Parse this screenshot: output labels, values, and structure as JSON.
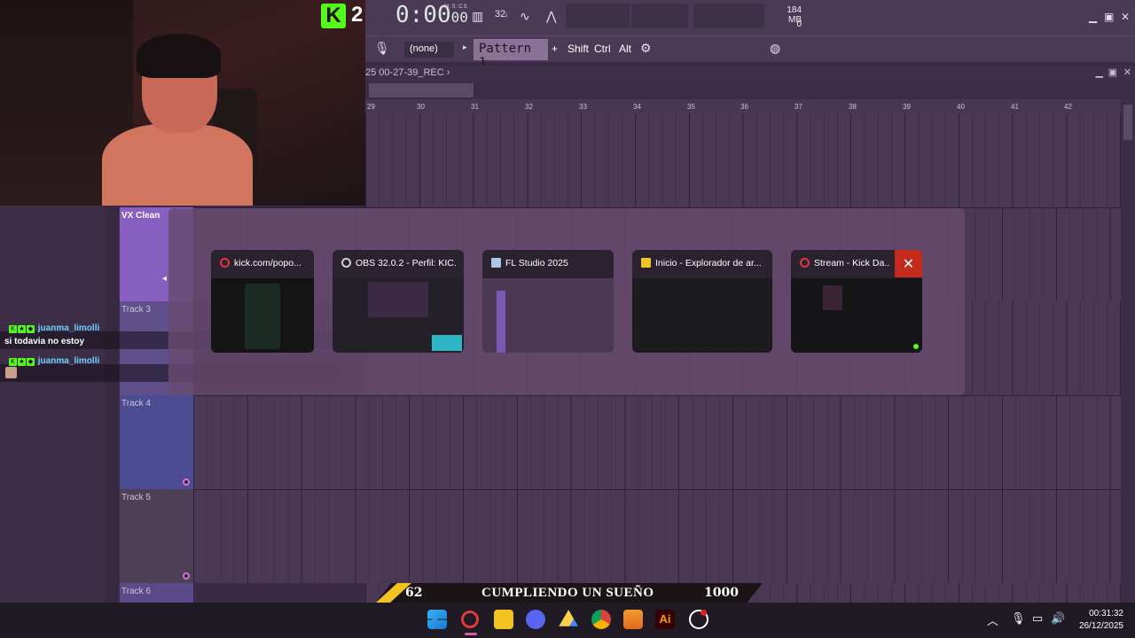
{
  "stream": {
    "platform_badge": "K",
    "viewer_count": "2"
  },
  "fl": {
    "time_main": "0:00",
    "time_sub": "00",
    "time_mode": "M:S:CS",
    "mem_mb": "184 MB",
    "mem_sub": "0",
    "input_select": "(none)",
    "pattern_label": "Pattern 1",
    "pattern_add": "+",
    "modifiers": [
      "Shift",
      "Ctrl",
      "Alt"
    ],
    "playlist_title": "25 00-27-39_REC",
    "ruler": [
      "29",
      "30",
      "31",
      "32",
      "33",
      "34",
      "35",
      "36",
      "37",
      "38",
      "39",
      "40",
      "41",
      "42"
    ],
    "tracks": [
      {
        "name": "VX Clean"
      },
      {
        "name": "Track 3"
      },
      {
        "name": "Track 4"
      },
      {
        "name": "Track 5"
      },
      {
        "name": "Track 6"
      }
    ]
  },
  "chat": {
    "messages": [
      {
        "user": "juanma_limolli",
        "text": "si todavia no estoy"
      },
      {
        "user": "juanma_limolli",
        "text": ""
      }
    ]
  },
  "alttab": {
    "windows": [
      {
        "title": "kick.com/popo...",
        "icon": "opera-icon",
        "color": "#e03a3a"
      },
      {
        "title": "OBS 32.0.2 - Perfil: KIC...",
        "icon": "obs-icon",
        "color": "#cfcfcf"
      },
      {
        "title": "FL Studio 2025",
        "icon": "fl-studio-icon",
        "color": "#f29a2e"
      },
      {
        "title": "Inicio - Explorador de ar...",
        "icon": "folder-icon",
        "color": "#f3c321"
      },
      {
        "title": "Stream - Kick Da...",
        "icon": "opera-icon",
        "color": "#e03a3a"
      }
    ]
  },
  "banner": {
    "left_num": "62",
    "text": "CUMPLIENDO UN SUEÑO",
    "right_num": "1000"
  },
  "taskbar": {
    "time": "00:31:32",
    "date": "26/12/2025"
  }
}
